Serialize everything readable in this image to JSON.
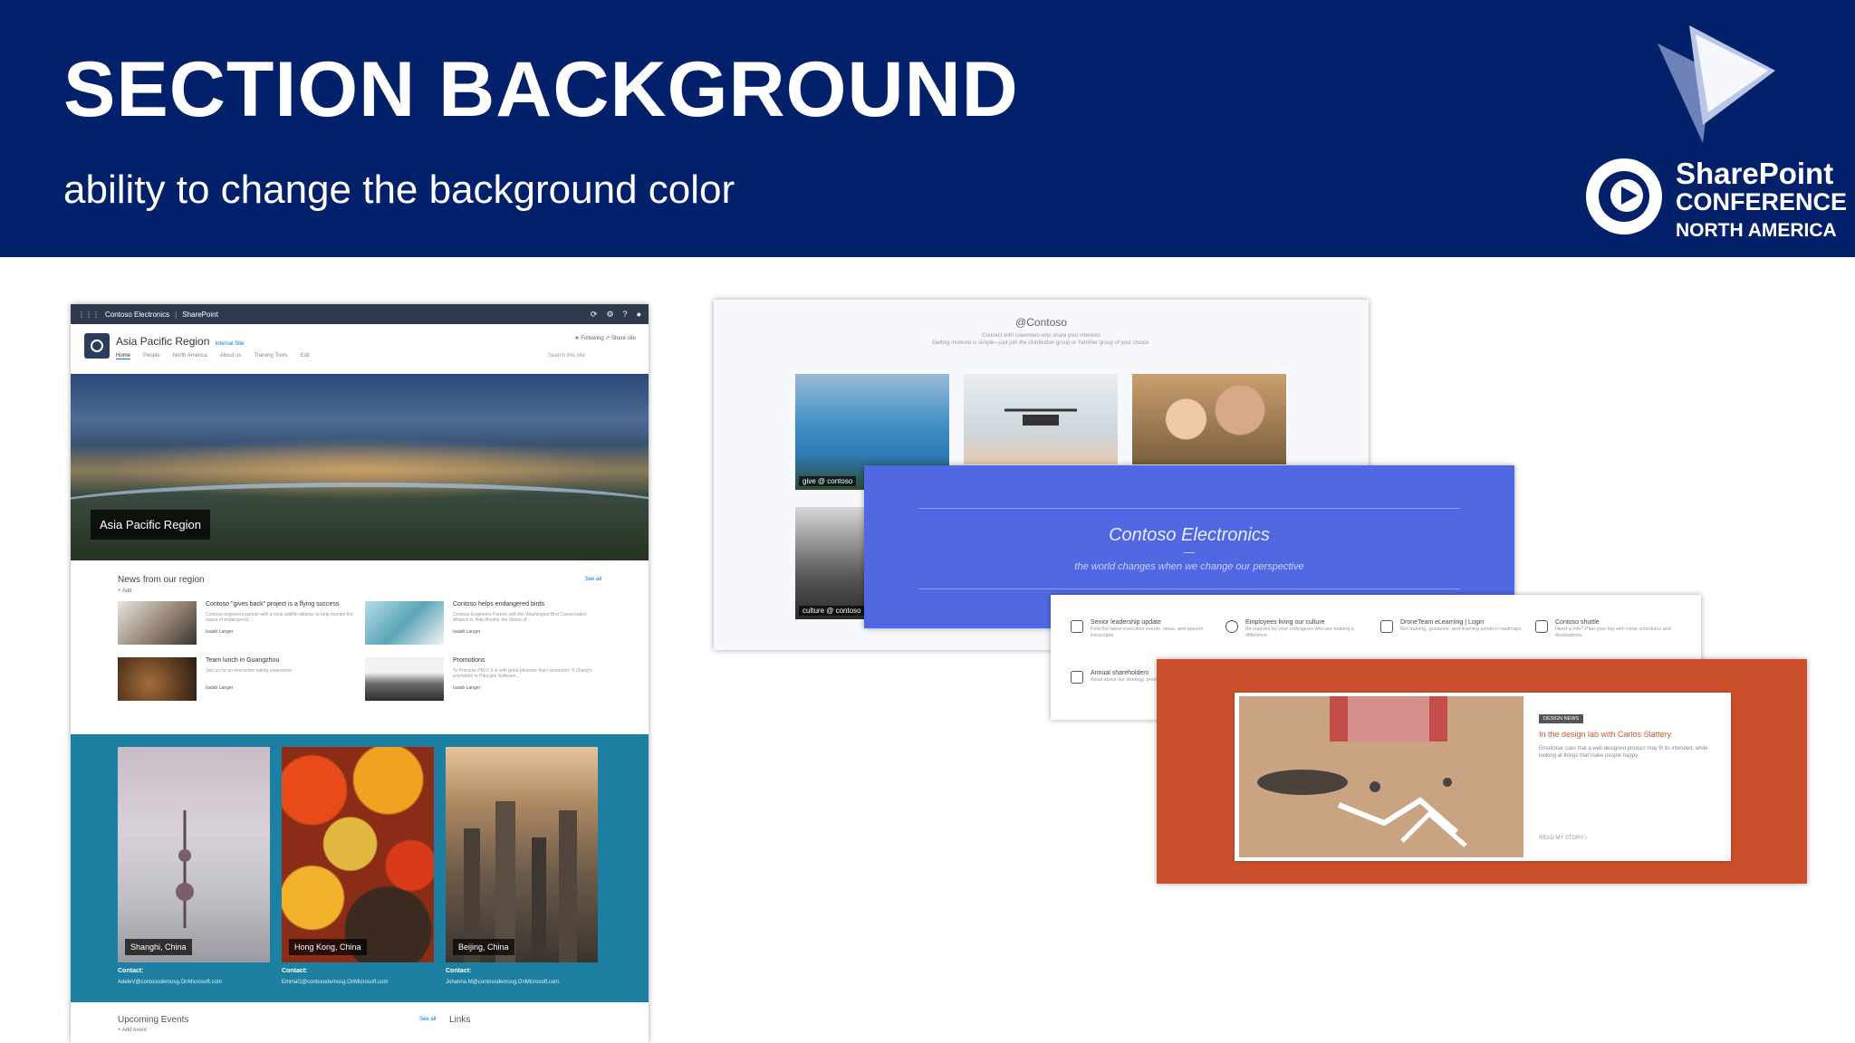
{
  "slide": {
    "title": "SECTION BACKGROUND",
    "subtitle": "ability to change the background color",
    "logo": {
      "line1": "SharePoint",
      "line2": "CONFERENCE",
      "line3": "NORTH AMERICA"
    }
  },
  "colors": {
    "banner": "#03206b",
    "teal_band": "#1d7fa2",
    "blue_section": "#5168e3",
    "orange_section": "#c9502a"
  },
  "left_site": {
    "suitebar": {
      "brand": "Contoso Electronics",
      "app": "SharePoint"
    },
    "site_title": "Asia Pacific Region",
    "site_sub": "Internal Site",
    "nav": [
      "Home",
      "People",
      "North America",
      "About us",
      "Training Tools",
      "Edit"
    ],
    "follow": "★ Following   ↗ Share site",
    "search_placeholder": "Search this site",
    "hero_label": "Asia Pacific Region",
    "news": {
      "title": "News from our region",
      "see_all": "See all",
      "add": "+ Add",
      "items": [
        {
          "title": "Contoso \"gives back\" project is a flying success",
          "desc": "Contoso engineers partner with a local wildlife alliance to help monitor the status of endangered...",
          "meta": "Isaiah Langer"
        },
        {
          "title": "Contoso helps endangered birds",
          "desc": "Contoso Engineers Partner with the Washington Bird Conservation Alliance to help Monitor the Status of...",
          "meta": "Isaiah Langer"
        },
        {
          "title": "Team lunch in Guangzhou",
          "desc": "Join us for an interactive eating experience",
          "meta": "Isaiah Langer"
        },
        {
          "title": "Promotions",
          "desc": "To Principle PM II: It is with great pleasure that I announce Yi Zhang's promotion to Principle Software...",
          "meta": "Isaiah Langer"
        }
      ]
    },
    "cities": [
      {
        "label": "Shanghi, China",
        "contact_label": "Contact:",
        "contact": "AdeleV@contosodemosg.OnMicrosoft.com"
      },
      {
        "label": "Hong Kong, China",
        "contact_label": "Contact:",
        "contact": "EmmaG@contosodemosg.OnMicrosoft.com"
      },
      {
        "label": "Beijing, China",
        "contact_label": "Contact:",
        "contact": "Johanna.M@contosodemosg.OnMicrosoft.com"
      }
    ],
    "events_title": "Upcoming Events",
    "events_see_all": "See all",
    "events_add": "+ Add event",
    "links_title": "Links"
  },
  "right_sites": {
    "s1": {
      "title": "@Contoso",
      "sub1": "Connect with coworkers who share your interests",
      "sub2": "Getting involved is simple—just join the distribution group or Yammer group of your choice.",
      "tag1": "give @ contoso",
      "tag2": "culture @ contoso"
    },
    "s2": {
      "title": "Contoso Electronics",
      "tagline": "the world changes when we change our perspective"
    },
    "s3": {
      "items": [
        {
          "title": "Senior leadership update",
          "desc": "Find the latest executive events, news, and speech transcripts"
        },
        {
          "title": "Employees living our culture",
          "desc": "Be inspired by your colleagues who are making a difference"
        },
        {
          "title": "DroneTeam eLearning | Login",
          "desc": "Get training, guidance, and learning solution roadmaps"
        },
        {
          "title": "Contoso shuttle",
          "desc": "Need a ride? Plan your trip with route schedules and destinations"
        },
        {
          "title": "Annual shareholders",
          "desc": "Read about our strategy, products, and future"
        }
      ]
    },
    "s4": {
      "badge": "DESIGN NEWS",
      "headline": "In the design lab with Carlos Slattery",
      "desc": "Emotional cues that a well-designed product may fit its intended, while looking at things that make people happy.",
      "read": "READ MY STORY  ›"
    }
  }
}
